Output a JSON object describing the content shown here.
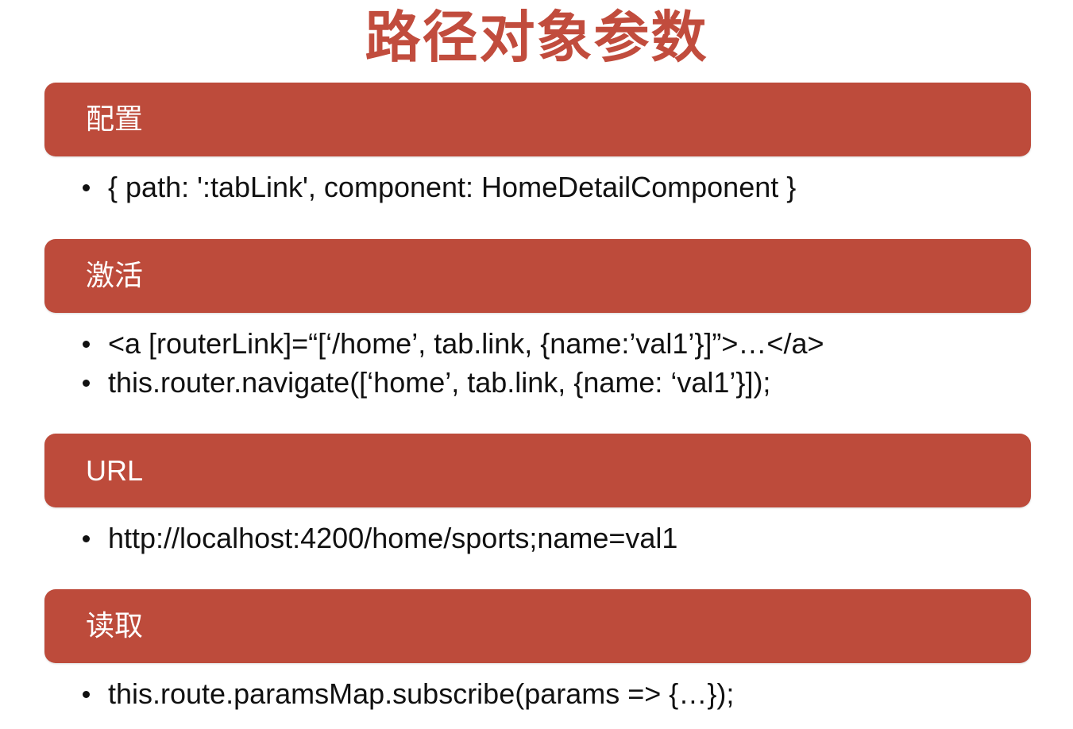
{
  "title": "路径对象参数",
  "colors": {
    "title": "#c14c3d",
    "section_bar": "#bd4b3b",
    "bullet": "#111111"
  },
  "sections": [
    {
      "label": "配置",
      "items": [
        "{ path: ':tabLink', component: HomeDetailComponent }"
      ]
    },
    {
      "label": "激活",
      "items": [
        "<a [routerLink]=“[‘/home’, tab.link, {name:’val1’}]”>…</a>",
        "this.router.navigate([‘home’, tab.link, {name: ‘val1’}]);"
      ]
    },
    {
      "label": "URL",
      "items": [
        "http://localhost:4200/home/sports;name=val1"
      ]
    },
    {
      "label": "读取",
      "items": [
        "this.route.paramsMap.subscribe(params => {…});"
      ]
    }
  ]
}
